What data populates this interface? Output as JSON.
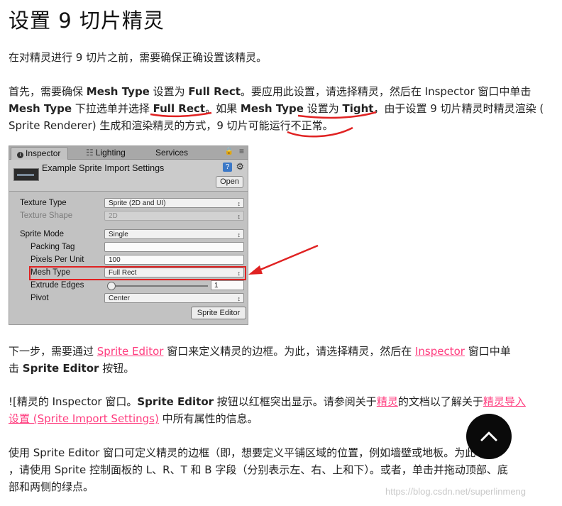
{
  "title": "设置 9 切片精灵",
  "intro": "在对精灵进行 9 切片之前，需要确保正确设置该精灵。",
  "para1": {
    "t1": "首先，需要确保 ",
    "b1": "Mesh Type",
    "t2": " 设置为 ",
    "b2": "Full Rect",
    "t3": "。要应用此设置，请选择精灵，然后在 Inspector 窗口中单击",
    "b3": "Mesh Type",
    "t4": " 下拉选单并选择 ",
    "b4": "Full Rect",
    "t5": "。如果 ",
    "b5": "Mesh Type",
    "t6": " 设置为 ",
    "b6": "Tight",
    "t7": "，由于设置 9 切片精灵时精灵渲染 (",
    "t8": "Sprite Renderer) 生成和渲染精灵的方式，9 切片可能运行不正常。"
  },
  "inspector": {
    "tab_inspector": "Inspector",
    "tab_lighting": "Lighting",
    "tab_services": "Services",
    "header_title": "Example Sprite Import Settings",
    "open_label": "Open",
    "texture_type_label": "Texture Type",
    "texture_type_value": "Sprite (2D and UI)",
    "texture_shape_label": "Texture Shape",
    "texture_shape_value": "2D",
    "sprite_mode_label": "Sprite Mode",
    "sprite_mode_value": "Single",
    "packing_tag_label": "Packing Tag",
    "packing_tag_value": "",
    "ppu_label": "Pixels Per Unit",
    "ppu_value": "100",
    "mesh_type_label": "Mesh Type",
    "mesh_type_value": "Full Rect",
    "extrude_label": "Extrude Edges",
    "extrude_value": "1",
    "pivot_label": "Pivot",
    "pivot_value": "Center",
    "sprite_editor_button": "Sprite Editor"
  },
  "para2": {
    "t1": "下一步，需要通过 ",
    "link1": "Sprite Editor",
    "t2": " 窗口来定义精灵的边框。为此，请选择精灵，然后在 ",
    "link2": "Inspector",
    "t3": " 窗口中单",
    "t4": "击 ",
    "b1": "Sprite Editor",
    "t5": " 按钮。"
  },
  "para3": {
    "t1": "![精灵的 Inspector 窗口。",
    "b1": "Sprite Editor",
    "t2": " 按钮以红框突出显示。请参阅关于",
    "link1": "精灵",
    "t3": "的文档以了解关于",
    "link2a": "精灵导入",
    "link2b": "设置 (Sprite Import Settings)",
    "t4": " 中所有属性的信息。"
  },
  "para4": {
    "line1": "使用 Sprite Editor 窗口可定义精灵的边框（即，想要定义平铺区域的位置，例如墙壁或地板",
    "line1b": "。为此",
    "line2": "，请使用 Sprite 控制面板的 L、R、T 和 B 字段（分别表示左、右、上和下）。或者，单击并拖动顶部、底",
    "line3": "部和两侧的绿点。"
  },
  "watermark": "https://blog.csdn.net/superlinmeng",
  "colors": {
    "link": "#ff3d7f",
    "annotation": "#e02222",
    "totop": "#0a0a0a"
  }
}
